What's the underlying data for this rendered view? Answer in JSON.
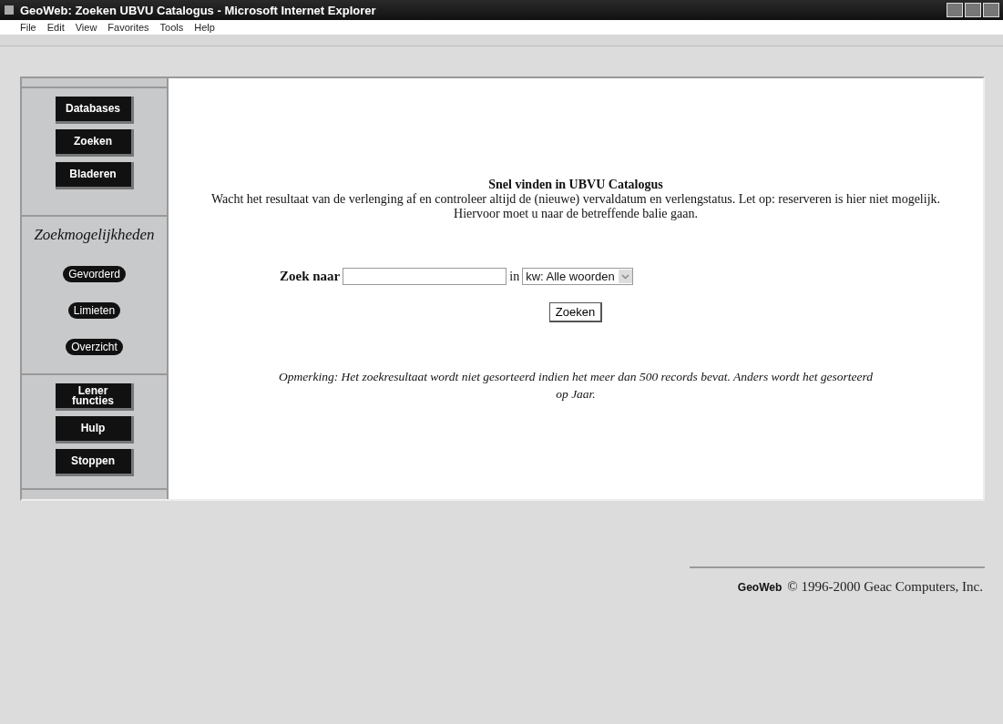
{
  "window": {
    "title": "GeoWeb: Zoeken UBVU Catalogus - Microsoft Internet Explorer"
  },
  "menu": [
    "File",
    "Edit",
    "View",
    "Favorites",
    "Tools",
    "Help"
  ],
  "sidebar": {
    "groups": [
      {
        "kind": "buttons",
        "items": [
          "Databases",
          "Zoeken",
          "Bladeren"
        ]
      },
      {
        "kind": "options",
        "heading": "Zoekmogelijkheden",
        "items": [
          "Gevorderd",
          "Limieten",
          "Overzicht"
        ]
      },
      {
        "kind": "buttons",
        "items": [
          "Lener functies",
          "Hulp",
          "Stoppen"
        ]
      }
    ]
  },
  "search": {
    "title": "Snel vinden in UBVU Catalogus",
    "intro": "Wacht het resultaat van de verlenging af en controleer altijd de (nieuwe) vervaldatum en verlengstatus. Let op: reserveren is hier niet mogelijk. Hiervoor moet u naar de betreffende balie gaan.",
    "label": "Zoek naar",
    "connector": "in",
    "field_select": "kw: Alle woorden",
    "button": "Zoeken",
    "note": "Opmerking: Het zoekresultaat wordt niet gesorteerd indien het meer dan 500 records bevat. Anders wordt het gesorteerd op Jaar."
  },
  "footer": {
    "logo": "GeoWeb",
    "copyright": "© 1996-2000 Geac Computers, Inc."
  }
}
